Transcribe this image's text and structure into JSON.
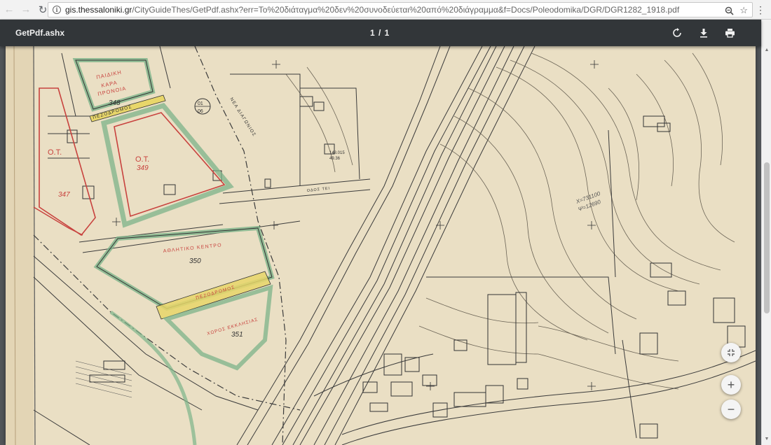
{
  "browser": {
    "url_host": "gis.thessaloniki.gr",
    "url_path": "/CityGuideThes/GetPdf.ashx?err=To%20διάταγμα%20δεν%20συνοδεύεται%20από%20διάγραμμα&f=Docs/Poleodomika/DGR/DGR1282_1918.pdf",
    "back_icon": "back-arrow-icon",
    "forward_icon": "forward-arrow-icon",
    "reload_icon": "reload-icon"
  },
  "pdf_toolbar": {
    "title": "GetPdf.ashx",
    "page_indicator": "1 / 1",
    "rotate_icon": "rotate-icon",
    "download_icon": "download-icon",
    "print_icon": "print-icon"
  },
  "zoom_controls": {
    "fit_icon": "fit-to-page-icon",
    "zoom_in_label": "+",
    "zoom_out_label": "−"
  },
  "map_labels": {
    "block_paidiki": [
      "ΠΑΙΔΙΚΗ",
      "ΚΑΡΑ",
      "ΠΡΟΝΟΙΑ"
    ],
    "block_348": "348",
    "pezodromos_top": "ΠΕΖΟΔΡΟΜΟΣ",
    "ot_349_label": "Ο.Τ.",
    "ot_349": "349",
    "ot_347_label": "Ο.Τ.",
    "ot_347": "347",
    "circle_top": "01",
    "circle_bottom": "06",
    "nea_diagonios": "ΝΕΑ ΔΙΑΓΩΝΙΟΣ",
    "odos_label": "ΟΔΟΣ ΤΕΙ",
    "athletic_center": "ΑΘΛΗΤΙΚΟ ΚΕΝΤΡΟ",
    "block_350": "350",
    "pezodromos_mid": "ΠΕΖΟΔΡΟΜΟΣ",
    "xoros_ekklisias": "ΧΩΡΟΣ ΕΚΚΛΗΣΙΑΣ",
    "block_351": "351",
    "elev_1": "148.015",
    "elev_2": "49.36",
    "coord_note_1": "X=731100",
    "coord_note_2": "Ψ=12690"
  },
  "colors": {
    "paper": "#eadfc4",
    "line": "#3a3a3a",
    "red": "#c8423e",
    "green": "#7cb38a",
    "yellow": "#e8d66a"
  }
}
